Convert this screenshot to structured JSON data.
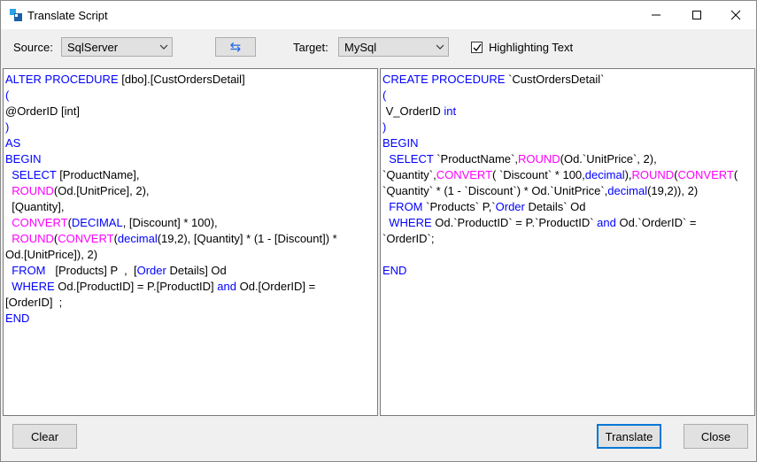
{
  "window": {
    "title": "Translate Script"
  },
  "toolbar": {
    "source_label": "Source:",
    "source_value": "SqlServer",
    "target_label": "Target:",
    "target_value": "MySql",
    "swap_glyph": "⇆",
    "highlight_label": "Highlighting Text",
    "highlight_checked": true
  },
  "source_lines": [
    [
      {
        "t": "ALTER PROCEDURE",
        "c": "kw"
      },
      {
        "t": " [dbo].[CustOrdersDetail]"
      }
    ],
    [
      {
        "t": "(",
        "c": "kw"
      }
    ],
    [
      {
        "t": "@OrderID [int]"
      }
    ],
    [
      {
        "t": ")",
        "c": "kw"
      }
    ],
    [
      {
        "t": "AS",
        "c": "kw"
      }
    ],
    [
      {
        "t": "BEGIN",
        "c": "kw"
      }
    ],
    [
      {
        "t": "  "
      },
      {
        "t": "SELECT",
        "c": "kw"
      },
      {
        "t": " [ProductName],"
      }
    ],
    [
      {
        "t": "  "
      },
      {
        "t": "ROUND",
        "c": "fn"
      },
      {
        "t": "(Od.[UnitPrice], 2),"
      }
    ],
    [
      {
        "t": "  [Quantity],"
      }
    ],
    [
      {
        "t": "  "
      },
      {
        "t": "CONVERT",
        "c": "fn"
      },
      {
        "t": "("
      },
      {
        "t": "DECIMAL",
        "c": "kw"
      },
      {
        "t": ", [Discount] * 100),"
      }
    ],
    [
      {
        "t": "  "
      },
      {
        "t": "ROUND",
        "c": "fn"
      },
      {
        "t": "("
      },
      {
        "t": "CONVERT",
        "c": "fn"
      },
      {
        "t": "("
      },
      {
        "t": "decimal",
        "c": "kw"
      },
      {
        "t": "(19,2), [Quantity] * (1 - [Discount]) *"
      }
    ],
    [
      {
        "t": "Od.[UnitPrice]), 2)"
      }
    ],
    [
      {
        "t": "  "
      },
      {
        "t": "FROM",
        "c": "kw"
      },
      {
        "t": "   [Products] P  ,  ["
      },
      {
        "t": "Order",
        "c": "kw"
      },
      {
        "t": " Details] Od"
      }
    ],
    [
      {
        "t": "  "
      },
      {
        "t": "WHERE",
        "c": "kw"
      },
      {
        "t": " Od.[ProductID] = P.[ProductID] "
      },
      {
        "t": "and",
        "c": "kw"
      },
      {
        "t": " Od.[OrderID] ="
      }
    ],
    [
      {
        "t": "[OrderID]  ;"
      }
    ],
    [
      {
        "t": "END",
        "c": "kw"
      }
    ]
  ],
  "target_lines": [
    [
      {
        "t": "CREATE PROCEDURE",
        "c": "kw"
      },
      {
        "t": " `CustOrdersDetail`"
      }
    ],
    [
      {
        "t": "(",
        "c": "kw"
      }
    ],
    [
      {
        "t": " V_OrderID "
      },
      {
        "t": "int",
        "c": "kw"
      }
    ],
    [
      {
        "t": ")",
        "c": "kw"
      }
    ],
    [
      {
        "t": "BEGIN",
        "c": "kw"
      }
    ],
    [
      {
        "t": "  "
      },
      {
        "t": "SELECT",
        "c": "kw"
      },
      {
        "t": " `ProductName`,"
      },
      {
        "t": "ROUND",
        "c": "fn"
      },
      {
        "t": "(Od.`UnitPrice`, 2),"
      }
    ],
    [
      {
        "t": "`Quantity`,"
      },
      {
        "t": "CONVERT",
        "c": "fn"
      },
      {
        "t": "( `Discount` * 100,"
      },
      {
        "t": "decimal",
        "c": "kw"
      },
      {
        "t": "),"
      },
      {
        "t": "ROUND",
        "c": "fn"
      },
      {
        "t": "("
      },
      {
        "t": "CONVERT",
        "c": "fn"
      },
      {
        "t": "("
      }
    ],
    [
      {
        "t": "`Quantity` * (1 - `Discount`) * Od.`UnitPrice`,"
      },
      {
        "t": "decimal",
        "c": "kw"
      },
      {
        "t": "(19,2)), 2)"
      }
    ],
    [
      {
        "t": "  "
      },
      {
        "t": "FROM",
        "c": "kw"
      },
      {
        "t": " `Products` P,`"
      },
      {
        "t": "Order",
        "c": "kw"
      },
      {
        "t": " Details` Od"
      }
    ],
    [
      {
        "t": "  "
      },
      {
        "t": "WHERE",
        "c": "kw"
      },
      {
        "t": " Od.`ProductID` = P.`ProductID` "
      },
      {
        "t": "and",
        "c": "kw"
      },
      {
        "t": " Od.`OrderID` ="
      }
    ],
    [
      {
        "t": "`OrderID`;"
      }
    ],
    [
      {
        "t": ""
      }
    ],
    [
      {
        "t": "END",
        "c": "kw"
      }
    ]
  ],
  "buttons": {
    "clear": "Clear",
    "translate": "Translate",
    "close": "Close"
  },
  "colors": {
    "keyword": "#0000ff",
    "function": "#ff00ff",
    "accent": "#0078d7"
  },
  "icons": {
    "app": "translate-app-icon",
    "minimize": "minimize-icon",
    "maximize": "maximize-icon",
    "close": "close-icon"
  }
}
